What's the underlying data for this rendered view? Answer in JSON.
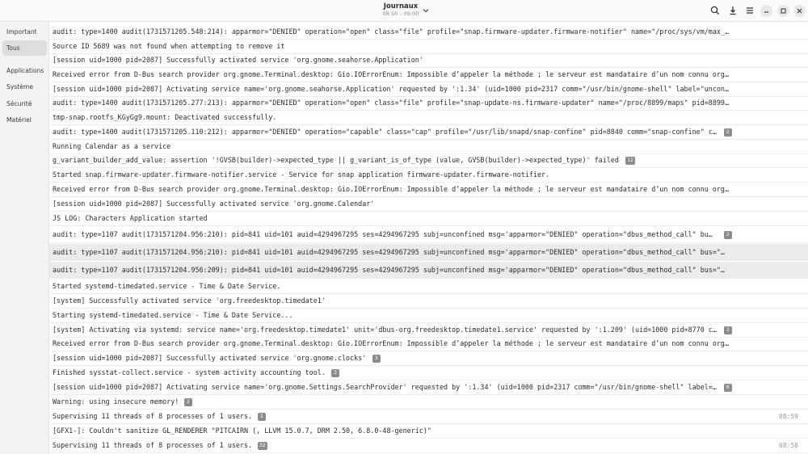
{
  "header": {
    "title": "Journaux",
    "subtitle": "08:50 – 09:00"
  },
  "icons": {
    "search": "search-icon",
    "export": "export-icon",
    "menu": "menu-icon",
    "minimize": "minimize-icon",
    "maximize": "maximize-icon",
    "close": "close-icon",
    "chevron": "chevron-down-icon"
  },
  "sidebar": {
    "items": [
      {
        "label": "Important"
      },
      {
        "label": "Tous"
      },
      {
        "label": "Applications"
      },
      {
        "label": "Système"
      },
      {
        "label": "Sécurité"
      },
      {
        "label": "Matériel"
      }
    ]
  },
  "rows": [
    {
      "text": "audit: type=1400 audit(1731571205.548:214): apparmor=\"DENIED\" operation=\"open\" class=\"file\" profile=\"snap.firmware-updater.firmware-notifier\" name=\"/proc/sys/vm/max_…",
      "badge": "",
      "time": ""
    },
    {
      "text": "Source ID 5689 was not found when attempting to remove it",
      "badge": "",
      "time": ""
    },
    {
      "text": "[session uid=1000 pid=2087] Successfully activated service 'org.gnome.seahorse.Application'",
      "badge": "",
      "time": ""
    },
    {
      "text": "Received error from D-Bus search provider org.gnome.Terminal.desktop: Gio.IOErrorEnum: Impossible d’appeler la méthode ; le serveur est mandataire d’un nom connu org…",
      "badge": "",
      "time": ""
    },
    {
      "text": "[session uid=1000 pid=2087] Activating service name='org.gnome.seahorse.Application' requested by ':1.34' (uid=1000 pid=2317 comm=\"/usr/bin/gnome-shell\" label=\"uncon…",
      "badge": "",
      "time": ""
    },
    {
      "text": "audit: type=1400 audit(1731571205.277:213): apparmor=\"DENIED\" operation=\"open\" class=\"file\" profile=\"snap-update-ns.firmware-updater\" name=\"/proc/8899/maps\" pid=8899…",
      "badge": "",
      "time": ""
    },
    {
      "text": "tmp-snap.rootfs_KGyGg9.mount: Deactivated successfully.",
      "badge": "",
      "time": ""
    },
    {
      "text": "audit: type=1400 audit(1731571205.110:212): apparmor=\"DENIED\" operation=\"capable\" class=\"cap\" profile=\"/usr/lib/snapd/snap-confine\" pid=8840 comm=\"snap-confine\" c…",
      "badge": "2",
      "time": ""
    },
    {
      "text": "Running Calendar as a service",
      "badge": "",
      "time": ""
    },
    {
      "text": "g_variant_builder_add_value: assertion '!GVSB(builder)->expected_type || g_variant_is_of_type (value, GVSB(builder)->expected_type)' failed",
      "badge": "12",
      "time": ""
    },
    {
      "text": "Started snap.firmware-updater.firmware-notifier.service - Service for snap application firmware-updater.firmware-notifier.",
      "badge": "",
      "time": ""
    },
    {
      "text": "Received error from D-Bus search provider org.gnome.Terminal.desktop: Gio.IOErrorEnum: Impossible d’appeler la méthode ; le serveur est mandataire d’un nom connu org…",
      "badge": "",
      "time": ""
    },
    {
      "text": "[session uid=1000 pid=2087] Successfully activated service 'org.gnome.Calendar'",
      "badge": "",
      "time": ""
    },
    {
      "text": "JS LOG: Characters Application started",
      "badge": "",
      "time": ""
    },
    {
      "text": "audit: type=1107 audit(1731571204.956:210): pid=841 uid=101 auid=4294967295 ses=4294967295 subj=unconfined msg='apparmor=\"DENIED\" operation=\"dbus_method_call\"  bu…",
      "badge": "2",
      "time": ""
    },
    {
      "text": "audit: type=1107 audit(1731571204.956:210): pid=841 uid=101 auid=4294967295 ses=4294967295 subj=unconfined msg='apparmor=\"DENIED\" operation=\"dbus_method_call\"  bus=\"…",
      "badge": "",
      "time": ""
    },
    {
      "text": "audit: type=1107 audit(1731571204.956:209): pid=841 uid=101 auid=4294967295 ses=4294967295 subj=unconfined msg='apparmor=\"DENIED\" operation=\"dbus_method_call\"  bus=\"…",
      "badge": "",
      "time": ""
    },
    {
      "text": "Started systemd-timedated.service - Time & Date Service.",
      "badge": "",
      "time": ""
    },
    {
      "text": "[system] Successfully activated service 'org.freedesktop.timedate1'",
      "badge": "",
      "time": ""
    },
    {
      "text": "Starting systemd-timedated.service - Time & Date Service...",
      "badge": "",
      "time": ""
    },
    {
      "text": "[system] Activating via systemd: service name='org.freedesktop.timedate1' unit='dbus-org.freedesktop.timedate1.service' requested by ':1.209' (uid=1000 pid=8770 c…",
      "badge": "3",
      "time": ""
    },
    {
      "text": "Received error from D-Bus search provider org.gnome.Terminal.desktop: Gio.IOErrorEnum: Impossible d’appeler la méthode ; le serveur est mandataire d’un nom connu org…",
      "badge": "",
      "time": ""
    },
    {
      "text": "[session uid=1000 pid=2087] Successfully activated service 'org.gnome.clocks'",
      "badge": "3",
      "time": ""
    },
    {
      "text": "Finished sysstat-collect.service - system activity accounting tool.",
      "badge": "3",
      "time": ""
    },
    {
      "text": "[session uid=1000 pid=2087] Activating service name='org.gnome.Settings.SearchProvider' requested by ':1.34' (uid=1000 pid=2317 comm=\"/usr/bin/gnome-shell\" label=…",
      "badge": "6",
      "time": ""
    },
    {
      "text": "Warning: using insecure memory!",
      "badge": "2",
      "time": ""
    },
    {
      "text": "Supervising 11 threads of 8 processes of 1 users.",
      "badge": "2",
      "time": "08:59"
    },
    {
      "text": "[GFX1-]: Couldn't sanitize GL_RENDERER \"PITCAIRN (, LLVM 15.0.7, DRM 2.50, 6.8.0-48-generic)\"",
      "badge": "",
      "time": ""
    },
    {
      "text": "Supervising 11 threads of 8 processes of 1 users.",
      "badge": "32",
      "time": "08:58"
    }
  ],
  "selected_rows": [
    15,
    16
  ],
  "selected_sidebar": 1
}
